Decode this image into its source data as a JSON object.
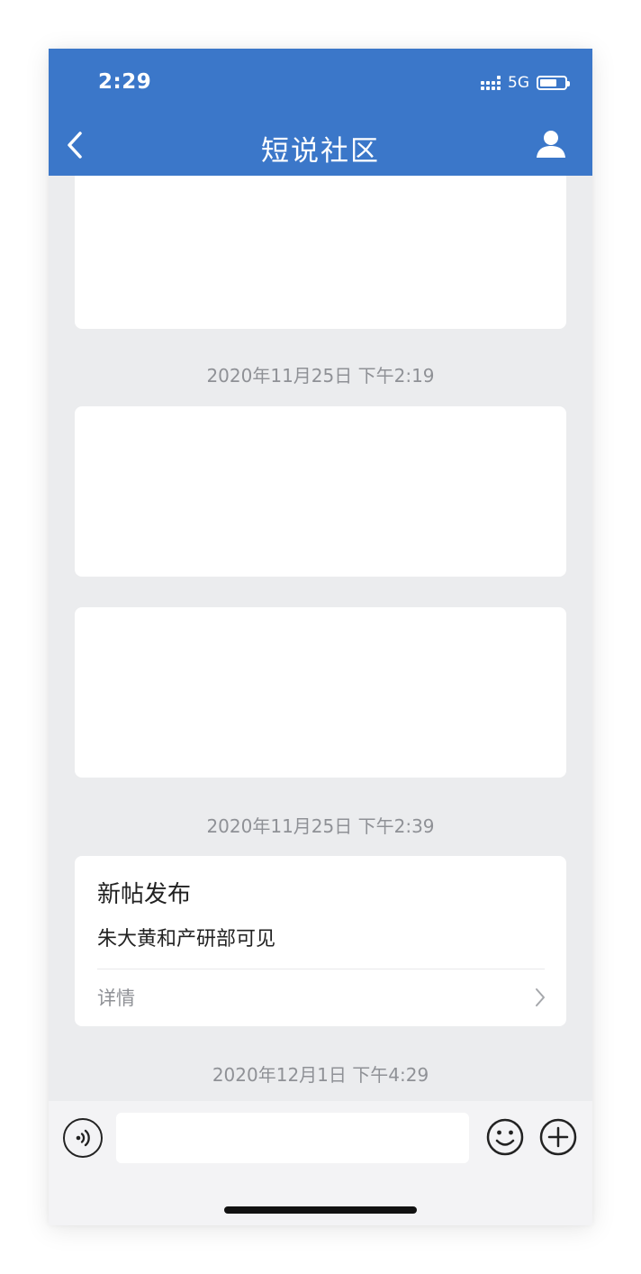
{
  "status_bar": {
    "time": "2:29",
    "network": "5G",
    "signal_icon": "signal-icon",
    "battery_icon": "battery-icon"
  },
  "nav": {
    "title": "短说社区",
    "back_icon": "chevron-left-icon",
    "profile_icon": "user-icon"
  },
  "feed": {
    "timestamps": [
      "2020年11月25日 下午2:19",
      "2020年11月25日 下午2:39",
      "2020年12月1日 下午4:29"
    ],
    "post": {
      "title": "新帖发布",
      "description": "朱大黄和产研部可见",
      "detail_label": "详情",
      "detail_icon": "chevron-right-icon"
    }
  },
  "input_bar": {
    "voice_icon": "voice-icon",
    "message_value": "",
    "emoji_icon": "emoji-icon",
    "plus_icon": "plus-circle-icon"
  },
  "colors": {
    "header": "#3b77c9",
    "background": "#ebecee",
    "card": "#ffffff",
    "timestamp_text": "#8f9196"
  }
}
